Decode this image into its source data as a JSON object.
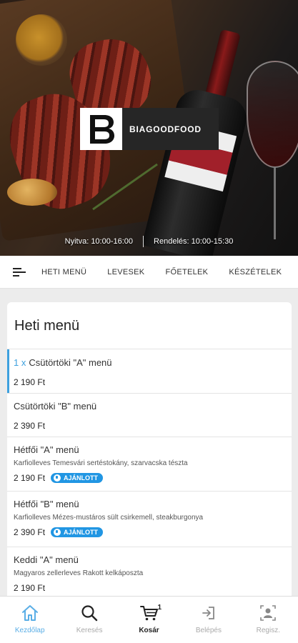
{
  "brand": {
    "name": "BIAGOODFOOD",
    "logo_letter": "B"
  },
  "hours": {
    "open": "Nyitva: 10:00-16:00",
    "order": "Rendelés: 10:00-15:30"
  },
  "categories": [
    "HETI MENÜ",
    "LEVESEK",
    "FŐETELEK",
    "KÉSZÉTELEK"
  ],
  "section_title": "Heti menü",
  "items": [
    {
      "qty": "1 x",
      "name": "Csütörtöki \"A\" menü",
      "desc": "",
      "price": "2 190 Ft",
      "badge": ""
    },
    {
      "qty": "",
      "name": "Csütörtöki \"B\" menü",
      "desc": "",
      "price": "2 390 Ft",
      "badge": ""
    },
    {
      "qty": "",
      "name": "Hétfői \"A\" menü",
      "desc": "Karfiolleves Temesvári sertéstokány, szarvacska tészta",
      "price": "2 190 Ft",
      "badge": "AJÁNLOTT"
    },
    {
      "qty": "",
      "name": "Hétfői \"B\" menü",
      "desc": "Karfiolleves Mézes-mustáros sült csirkemell, steakburgonya",
      "price": "2 390 Ft",
      "badge": "AJÁNLOTT"
    },
    {
      "qty": "",
      "name": "Keddi \"A\" menü",
      "desc": "Magyaros zellerleves Rakott kelkáposzta",
      "price": "2 190 Ft",
      "badge": ""
    }
  ],
  "bottom_nav": {
    "home": "Kezdőlap",
    "search": "Keresés",
    "cart": "Kosár",
    "cart_count": "1",
    "login": "Belépés",
    "register": "Regisz."
  },
  "colors": {
    "accent": "#3ea1df",
    "badge": "#2196e3",
    "logo_bg": "#262626"
  }
}
